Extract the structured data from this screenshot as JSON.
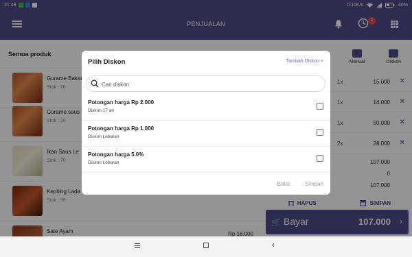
{
  "status_bar": {
    "time": "21:48",
    "network_speed": "0.10K/s",
    "battery": "40%"
  },
  "header": {
    "title": "PENJUALAN",
    "notification_count": "2"
  },
  "products": {
    "section_title": "Semua produk",
    "items": [
      {
        "name": "Gurame Bakar",
        "stock": "Stok : 20",
        "price": ""
      },
      {
        "name": "Gurame saus",
        "stock": "Stok : 20",
        "price": ""
      },
      {
        "name": "Ikan Saus Le",
        "stock": "Stok : 70",
        "price": ""
      },
      {
        "name": "Kepiting Lada",
        "stock": "Stok : 99",
        "price": ""
      },
      {
        "name": "Sate Ayam",
        "stock": "",
        "price": "Rp 18.000"
      }
    ]
  },
  "order_panel": {
    "tabs": [
      {
        "label": ""
      },
      {
        "label": ""
      },
      {
        "label": "Manual"
      },
      {
        "label": "Diskon"
      }
    ],
    "lines": [
      {
        "qty": "1x",
        "amount": "15.000"
      },
      {
        "qty": "1x",
        "amount": "14.000"
      },
      {
        "qty": "1x",
        "amount": "50.000"
      },
      {
        "qty": "2x",
        "amount": "28.000"
      }
    ],
    "summary": [
      "107.000",
      "0",
      "107.000"
    ],
    "hapus_label": "HAPUS",
    "simpan_label": "SIMPAN",
    "bayar_label": "Bayar",
    "bayar_total": "107.000"
  },
  "dialog": {
    "title": "Pilih Diskon",
    "add_label": "Tambah Diskon +",
    "search_placeholder": "Cari diskon",
    "options": [
      {
        "name": "Potongan harga Rp 2.000",
        "desc": "Diskon 17 an"
      },
      {
        "name": "Potongan harga Rp 1.000",
        "desc": "Diskon Lebaran"
      },
      {
        "name": "Potongan harga 5.0%",
        "desc": "Diskon Lebaran"
      }
    ],
    "cancel_label": "Batal",
    "save_label": "Simpan"
  },
  "colors": {
    "primary": "#4e4b88",
    "accent": "#6a66b5",
    "danger": "#e94b4b"
  }
}
